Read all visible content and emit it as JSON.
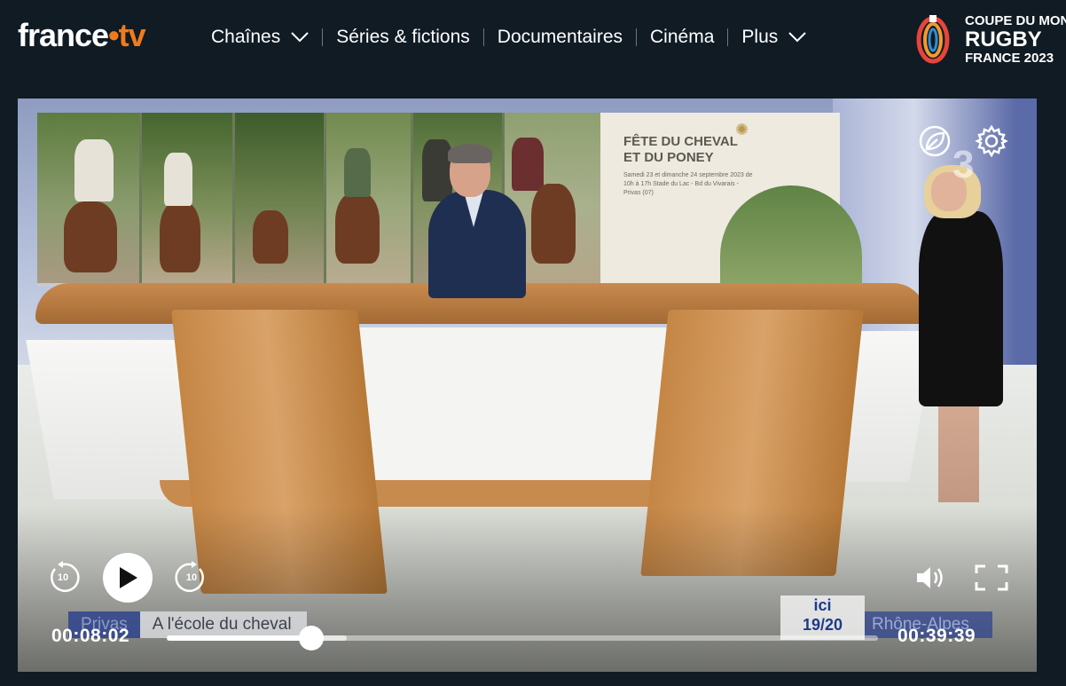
{
  "header": {
    "logo": {
      "brand": "france",
      "separator": "•",
      "suffix": "tv"
    },
    "nav": [
      {
        "label": "Chaînes",
        "has_dropdown": true
      },
      {
        "label": "Séries & fictions",
        "has_dropdown": false
      },
      {
        "label": "Documentaires",
        "has_dropdown": false
      },
      {
        "label": "Cinéma",
        "has_dropdown": false
      },
      {
        "label": "Plus",
        "has_dropdown": true
      }
    ],
    "promo": {
      "line1": "COUPE DU MONDE",
      "line2": "RUGBY",
      "line3": "FRANCE 2023"
    }
  },
  "player": {
    "video": {
      "poster_title_line1": "FÊTE DU CHEVAL",
      "poster_title_line2": "ET DU PONEY",
      "poster_details": "Samedi 23 et dimanche 24 septembre 2023 de 10h à 17h Stade du Lac - Bd du Vivarais - Privas (07)",
      "channel_logo": "3",
      "lower_third_tag": "Privas",
      "lower_third_text": "A l'école du cheval",
      "ici_top": "ici",
      "ici_bottom": "19/20",
      "region": "Rhône-Alpes"
    },
    "controls": {
      "rewind_seconds": "10",
      "forward_seconds": "10",
      "current_time": "00:08:02",
      "duration": "00:39:39",
      "progress_fraction": 0.203,
      "buffered_fraction": 0.253
    },
    "icons": {
      "eco": "leaf-icon",
      "settings": "gear-icon",
      "volume": "volume-icon",
      "fullscreen": "fullscreen-icon",
      "play": "play-icon"
    }
  },
  "colors": {
    "background": "#101b24",
    "accent": "#f07b1d"
  }
}
